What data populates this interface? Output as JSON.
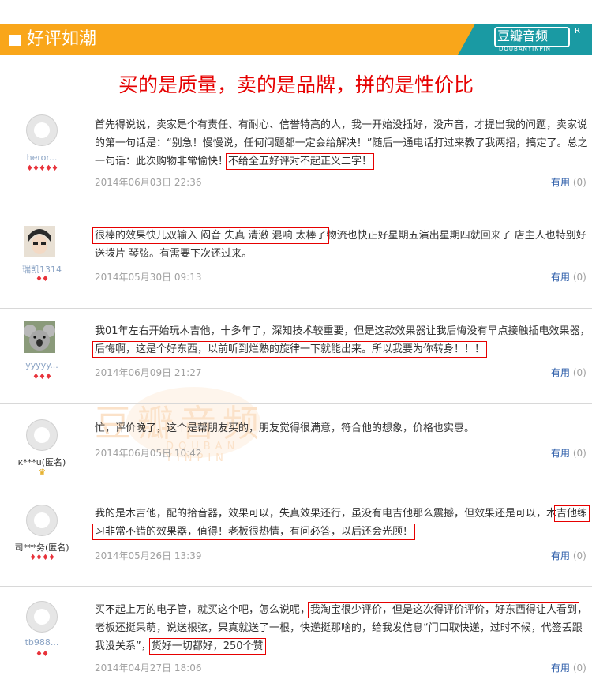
{
  "header": {
    "title": "好评如潮",
    "brand_name": "豆瓣音频",
    "brand_pinyin": "DOUBANYINPIN",
    "brand_mark": "R"
  },
  "slogan": "买的是质量，卖的是品牌，拼的是性价比",
  "watermark": {
    "main": "豆瓣音频",
    "sub": "DOUBAN YINPIN"
  },
  "reviews": [
    {
      "user": "heror...",
      "hearts": "♦♦♦♦♦",
      "text_before": "首先得说说，卖家是个有责任、有耐心、信誉特高的人，我一开始没插好，没声音，才提出我的问题，卖家说的第一句话是：“别急！慢慢说，任何问题都一定会给解决！”随后一通电话打过来教了我两招，搞定了。总之一句话：此次购物非常愉快！",
      "highlight": "不给全五好评对不起正义二字！",
      "text_after": "",
      "date": "2014年06月03日 22:36",
      "useful_label": "有用",
      "useful_count": "(0)"
    },
    {
      "user": "瑞凯1314",
      "hearts": "♦♦",
      "text_before": "",
      "highlight": "很棒的效果快儿双输入 闷音 失真 清澈 混响 太棒了",
      "text_after": "物流也快正好星期五演出星期四就回来了 店主人也特别好 送拨片 琴弦。有需要下次还过来。",
      "date": "2014年05月30日 09:13",
      "useful_label": "有用",
      "useful_count": "(0)"
    },
    {
      "user": "yyyyy...",
      "hearts": "♦♦♦",
      "text_before": "我01年左右开始玩木吉他，十多年了，深知技术较重要，但是这款效果器让我后悔没有早点接触插电效果器，",
      "highlight": "后悔啊，这是个好东西，以前听到烂熟的旋律一下就能出来。所以我要为你转身！！！",
      "text_after": "",
      "date": "2014年06月09日 21:27",
      "useful_label": "有用",
      "useful_count": "(0)"
    },
    {
      "user": "к***u(匿名)",
      "hearts": "♛",
      "text_before": "忙，评价晚了，这个是帮朋友买的，朋友觉得很满意，符合他的想象，价格也实惠。",
      "highlight": "",
      "text_after": "",
      "date": "2014年06月05日 10:42",
      "useful_label": "有用",
      "useful_count": "(0)"
    },
    {
      "user": "司***务(匿名)",
      "hearts": "♦♦♦♦",
      "text_before": "我的是木吉他，配的拾音器，效果可以，失真效果还行，虽没有电吉他那么震撼，但效果还是可以，木",
      "highlight": "吉他练习非常不错的效果器，值得！老板很热情，有问必答，以后还会光顾！",
      "text_after": "",
      "date": "2014年05月26日 13:39",
      "useful_label": "有用",
      "useful_count": "(0)"
    },
    {
      "user": "tb988...",
      "hearts": "♦♦",
      "text_before": "买不起上万的电子管，就买这个吧，怎么说呢，",
      "highlight": "我淘宝很少评价，但是这次得评价评价，好东西得让人看到",
      "text_after": "，老板还挺呆萌，说送根弦，果真就送了一根，快递挺那啥的，给我发信息“门口取快递，过时不候，代签丢跟我没关系”，",
      "highlight2": "货好一切都好，250个赞",
      "date": "2014年04月27日 18:06",
      "useful_label": "有用",
      "useful_count": "(0)"
    }
  ]
}
